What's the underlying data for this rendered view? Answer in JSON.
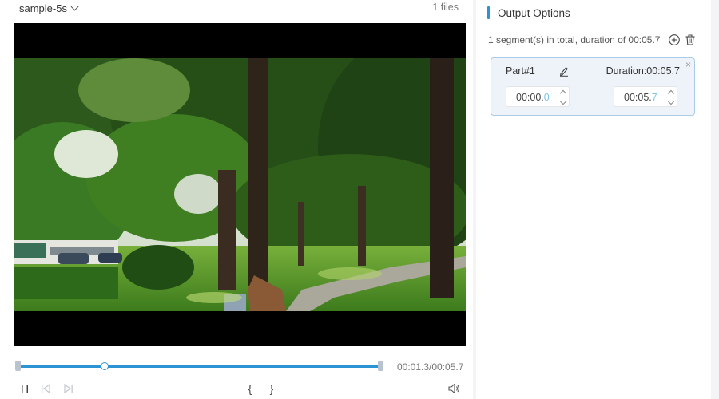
{
  "file_selector": {
    "label": "sample-5s",
    "icon": "chevron-down-icon"
  },
  "files_count": "1 files",
  "player": {
    "time_readout": "00:01.3/00:05.7",
    "progress": 0.228,
    "controls": {
      "pause_icon": "pause-icon",
      "prev_icon": "skip-previous-icon",
      "next_icon": "skip-next-icon",
      "mark_in": "{",
      "mark_out": "}",
      "volume_icon": "volume-icon"
    }
  },
  "output_options": {
    "title": "Output Options",
    "summary": "1 segment(s) in total, duration of 00:05.7",
    "add_icon": "add-circle-icon",
    "delete_icon": "trash-icon",
    "segments": [
      {
        "title": "Part#1",
        "duration": "Duration:00:05.7",
        "start_prefix": "00:00.",
        "start_last": "0",
        "end_prefix": "00:05.",
        "end_last": "7"
      }
    ]
  },
  "colors": {
    "accent": "#2c94d2",
    "card_bg": "#eef3f9",
    "card_border": "#a9cbe8"
  }
}
